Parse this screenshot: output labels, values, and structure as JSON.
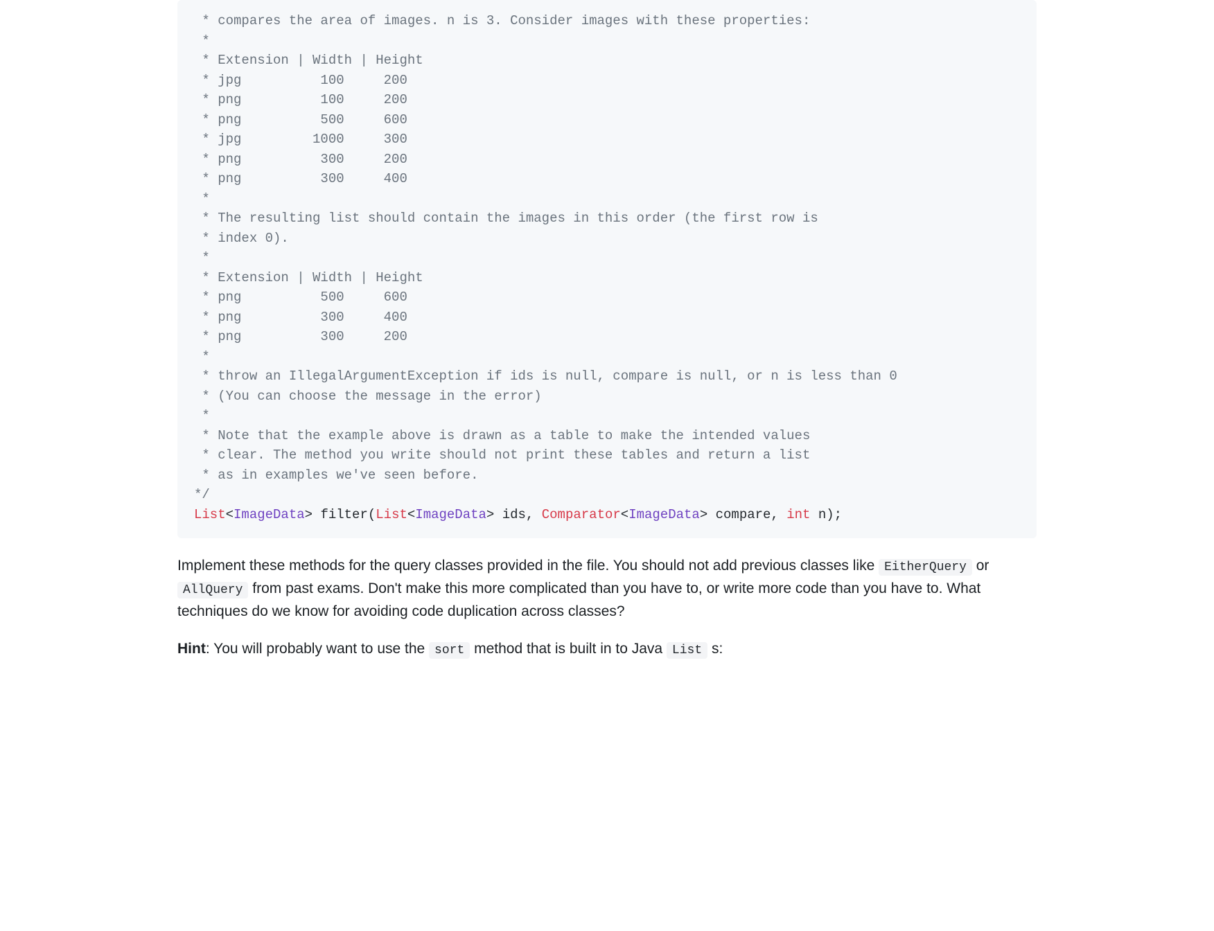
{
  "code": {
    "comment_lines": [
      " * compares the area of images. n is 3. Consider images with these properties:",
      " *",
      " * Extension | Width | Height",
      " * jpg          100     200",
      " * png          100     200",
      " * png          500     600",
      " * jpg         1000     300",
      " * png          300     200",
      " * png          300     400",
      " *",
      " * The resulting list should contain the images in this order (the first row is",
      " * index 0).",
      " *",
      " * Extension | Width | Height",
      " * png          500     600",
      " * png          300     400",
      " * png          300     200",
      " *",
      " * throw an IllegalArgumentException if ids is null, compare is null, or n is less than 0",
      " * (You can choose the message in the error)",
      " *",
      " * Note that the example above is drawn as a table to make the intended values",
      " * clear. The method you write should not print these tables and return a list",
      " * as in examples we've seen before.",
      "*/"
    ],
    "signature": {
      "t_list": "List",
      "lt1": "<",
      "t_imgdata1": "ImageData",
      "gt1": ">",
      "sp1": " ",
      "name_open": "filter(",
      "t_list2": "List",
      "lt2": "<",
      "t_imgdata2": "ImageData",
      "gt2": ">",
      "arg1": " ids, ",
      "t_comp": "Comparator",
      "lt3": "<",
      "t_imgdata3": "ImageData",
      "gt3": ">",
      "arg2": " compare, ",
      "kw_int": "int",
      "arg3": " n);"
    }
  },
  "para1": {
    "pre": "Implement these methods for the query classes provided in the file. You should not add previous classes like ",
    "code1": "EitherQuery",
    "mid1": " or ",
    "code2": "AllQuery",
    "post": " from past exams. Don't make this more complicated than you have to, or write more code than you have to. What techniques do we know for avoiding code duplication across classes?"
  },
  "para2": {
    "bold": "Hint",
    "pre": ": You will probably want to use the ",
    "code1": "sort",
    "mid": " method that is built in to Java ",
    "code2": "List",
    "post": " s:"
  }
}
